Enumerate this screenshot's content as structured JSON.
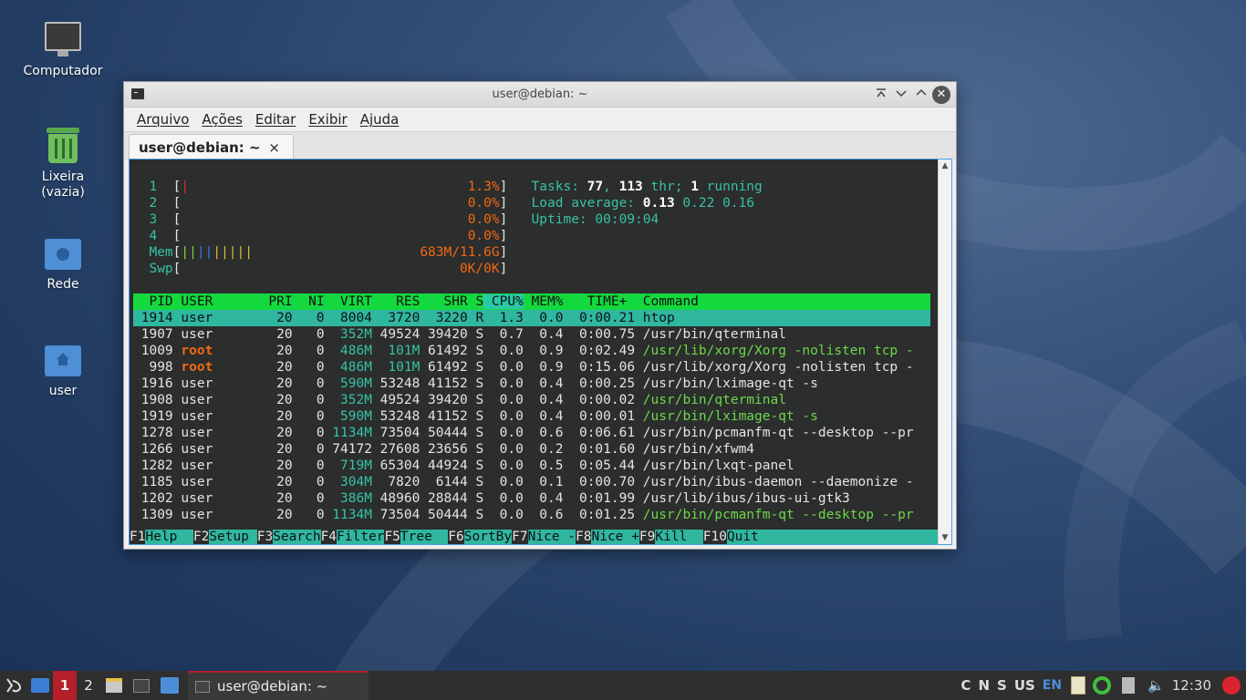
{
  "desktop": {
    "icons": [
      {
        "label": "Computador"
      },
      {
        "label": "Lixeira\n(vazia)"
      },
      {
        "label": "Rede"
      },
      {
        "label": "user"
      }
    ]
  },
  "window": {
    "title": "user@debian: ~",
    "menu": [
      "Arquivo",
      "Ações",
      "Editar",
      "Exibir",
      "Ajuda"
    ],
    "tab_label": "user@debian: ~",
    "tab_close": "×"
  },
  "htop": {
    "cpus": [
      {
        "id": "1",
        "pct": "1.3%"
      },
      {
        "id": "2",
        "pct": "0.0%"
      },
      {
        "id": "3",
        "pct": "0.0%"
      },
      {
        "id": "4",
        "pct": "0.0%"
      }
    ],
    "mem_label": "Mem",
    "mem_value": "683M/11.6G",
    "swp_label": "Swp",
    "swp_value": "0K/0K",
    "tasks_prefix": "Tasks: ",
    "tasks_count": "77",
    "tasks_sep": ", ",
    "thr_count": "113",
    "thr_label": " thr; ",
    "running_count": "1",
    "running_label": " running",
    "load_label": "Load average: ",
    "load1": "0.13",
    "load5": "0.22",
    "load15": "0.16",
    "uptime_label": "Uptime: ",
    "uptime_value": "00:09:04",
    "header": {
      "pid": "  PID",
      "user": " USER     ",
      "pri": "  PRI",
      "ni": "  NI",
      "virt": "  VIRT",
      "res": "   RES",
      "shr": "   SHR",
      "s": " S",
      "cpu": " CPU%",
      "mem": " MEM%",
      "time": "   TIME+ ",
      "cmd": " Command                         "
    },
    "processes": [
      {
        "pid": " 1914",
        "user": "user",
        "pri": "20",
        "ni": "0",
        "virt": "8004",
        "res": "3720",
        "shr": "3220",
        "s": "R",
        "cpu": "1.3",
        "mem": "0.0",
        "time": "0:00.21",
        "cmd": "htop"
      },
      {
        "pid": " 1907",
        "user": "user",
        "pri": "20",
        "ni": "0",
        "virt": "352M",
        "res": "49524",
        "shr": "39420",
        "s": "S",
        "cpu": "0.7",
        "mem": "0.4",
        "time": "0:00.75",
        "cmd": "/usr/bin/qterminal"
      },
      {
        "pid": " 1009",
        "user": "root",
        "pri": "20",
        "ni": "0",
        "virt": "486M",
        "res": "101M",
        "shr": "61492",
        "s": "S",
        "cpu": "0.0",
        "mem": "0.9",
        "time": "0:02.49",
        "cmd": "/usr/lib/xorg/Xorg -nolisten tcp -"
      },
      {
        "pid": "  998",
        "user": "root",
        "pri": "20",
        "ni": "0",
        "virt": "486M",
        "res": "101M",
        "shr": "61492",
        "s": "S",
        "cpu": "0.0",
        "mem": "0.9",
        "time": "0:15.06",
        "cmd": "/usr/lib/xorg/Xorg -nolisten tcp -"
      },
      {
        "pid": " 1916",
        "user": "user",
        "pri": "20",
        "ni": "0",
        "virt": "590M",
        "res": "53248",
        "shr": "41152",
        "s": "S",
        "cpu": "0.0",
        "mem": "0.4",
        "time": "0:00.25",
        "cmd": "/usr/bin/lximage-qt -s"
      },
      {
        "pid": " 1908",
        "user": "user",
        "pri": "20",
        "ni": "0",
        "virt": "352M",
        "res": "49524",
        "shr": "39420",
        "s": "S",
        "cpu": "0.0",
        "mem": "0.4",
        "time": "0:00.02",
        "cmd": "/usr/bin/qterminal"
      },
      {
        "pid": " 1919",
        "user": "user",
        "pri": "20",
        "ni": "0",
        "virt": "590M",
        "res": "53248",
        "shr": "41152",
        "s": "S",
        "cpu": "0.0",
        "mem": "0.4",
        "time": "0:00.01",
        "cmd": "/usr/bin/lximage-qt -s"
      },
      {
        "pid": " 1278",
        "user": "user",
        "pri": "20",
        "ni": "0",
        "virt": "1134M",
        "res": "73504",
        "shr": "50444",
        "s": "S",
        "cpu": "0.0",
        "mem": "0.6",
        "time": "0:06.61",
        "cmd": "/usr/bin/pcmanfm-qt --desktop --pr"
      },
      {
        "pid": " 1266",
        "user": "user",
        "pri": "20",
        "ni": "0",
        "virt": "74172",
        "res": "27608",
        "shr": "23656",
        "s": "S",
        "cpu": "0.0",
        "mem": "0.2",
        "time": "0:01.60",
        "cmd": "/usr/bin/xfwm4"
      },
      {
        "pid": " 1282",
        "user": "user",
        "pri": "20",
        "ni": "0",
        "virt": "719M",
        "res": "65304",
        "shr": "44924",
        "s": "S",
        "cpu": "0.0",
        "mem": "0.5",
        "time": "0:05.44",
        "cmd": "/usr/bin/lxqt-panel"
      },
      {
        "pid": " 1185",
        "user": "user",
        "pri": "20",
        "ni": "0",
        "virt": "304M",
        "res": "7820",
        "shr": "6144",
        "s": "S",
        "cpu": "0.0",
        "mem": "0.1",
        "time": "0:00.70",
        "cmd": "/usr/bin/ibus-daemon --daemonize -"
      },
      {
        "pid": " 1202",
        "user": "user",
        "pri": "20",
        "ni": "0",
        "virt": "386M",
        "res": "48960",
        "shr": "28844",
        "s": "S",
        "cpu": "0.0",
        "mem": "0.4",
        "time": "0:01.99",
        "cmd": "/usr/lib/ibus/ibus-ui-gtk3"
      },
      {
        "pid": " 1309",
        "user": "user",
        "pri": "20",
        "ni": "0",
        "virt": "1134M",
        "res": "73504",
        "shr": "50444",
        "s": "S",
        "cpu": "0.0",
        "mem": "0.6",
        "time": "0:01.25",
        "cmd": "/usr/bin/pcmanfm-qt --desktop --pr"
      }
    ],
    "fkeys": [
      {
        "key": "F1",
        "label": "Help  "
      },
      {
        "key": "F2",
        "label": "Setup "
      },
      {
        "key": "F3",
        "label": "Search"
      },
      {
        "key": "F4",
        "label": "Filter"
      },
      {
        "key": "F5",
        "label": "Tree  "
      },
      {
        "key": "F6",
        "label": "SortBy"
      },
      {
        "key": "F7",
        "label": "Nice -"
      },
      {
        "key": "F8",
        "label": "Nice +"
      },
      {
        "key": "F9",
        "label": "Kill  "
      },
      {
        "key": "F10",
        "label": "Quit                          "
      }
    ]
  },
  "taskbar": {
    "desktop1": "1",
    "desktop2": "2",
    "task_label": "user@debian: ~",
    "tray_keys": [
      "C",
      "N",
      "S",
      "US"
    ],
    "lang": "EN",
    "clock": "12:30"
  },
  "colors": {
    "accent_red": "#b51f2a",
    "htop_header_green": "#14d93e",
    "htop_selected": "#2fb7a0"
  }
}
